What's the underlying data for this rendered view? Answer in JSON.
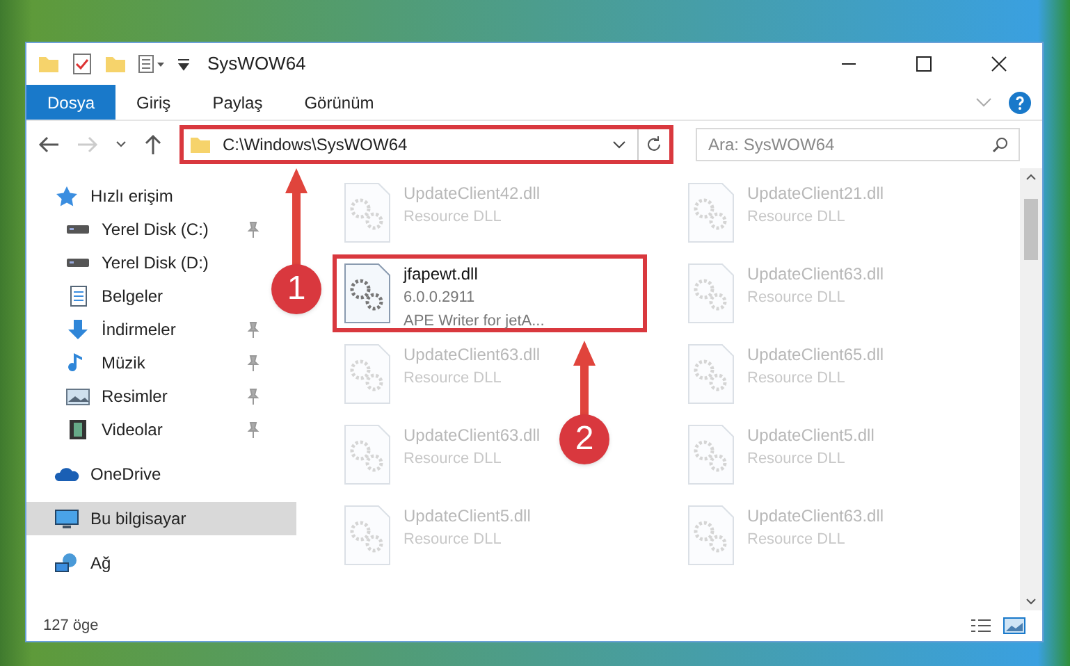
{
  "window": {
    "title": "SysWOW64"
  },
  "ribbon_tabs": [
    {
      "label": "Dosya",
      "selected": true
    },
    {
      "label": "Giriş",
      "selected": false
    },
    {
      "label": "Paylaş",
      "selected": false
    },
    {
      "label": "Görünüm",
      "selected": false
    }
  ],
  "address": {
    "path": "C:\\Windows\\SysWOW64",
    "highlighted": true
  },
  "search": {
    "placeholder": "Ara: SysWOW64"
  },
  "sidebar": {
    "items": [
      {
        "label": "Hızlı erişim",
        "kind": "star",
        "pinned": false,
        "selected": false,
        "children": [
          {
            "label": "Yerel Disk (C:)",
            "kind": "disk",
            "pinned": true,
            "selected": false
          },
          {
            "label": "Yerel Disk (D:)",
            "kind": "disk",
            "pinned": false,
            "selected": false
          },
          {
            "label": "Belgeler",
            "kind": "doc",
            "pinned": false,
            "selected": false
          },
          {
            "label": "İndirmeler",
            "kind": "download",
            "pinned": true,
            "selected": false
          },
          {
            "label": "Müzik",
            "kind": "music",
            "pinned": true,
            "selected": false
          },
          {
            "label": "Resimler",
            "kind": "picture",
            "pinned": true,
            "selected": false
          },
          {
            "label": "Videolar",
            "kind": "video",
            "pinned": true,
            "selected": false
          }
        ]
      },
      {
        "label": "OneDrive",
        "kind": "cloud",
        "pinned": false,
        "selected": false
      },
      {
        "label": "Bu bilgisayar",
        "kind": "computer",
        "pinned": false,
        "selected": true
      },
      {
        "label": "Ağ",
        "kind": "network",
        "pinned": false,
        "selected": false
      }
    ]
  },
  "files": [
    {
      "name": "UpdateClient42.dll",
      "lines": [
        "Resource DLL"
      ],
      "dimmed": true,
      "highlighted": false
    },
    {
      "name": "UpdateClient21.dll",
      "lines": [
        "Resource DLL"
      ],
      "dimmed": true,
      "highlighted": false
    },
    {
      "name": "jfapewt.dll",
      "lines": [
        "6.0.0.2911",
        "APE Writer for jetA..."
      ],
      "dimmed": false,
      "highlighted": true
    },
    {
      "name": "UpdateClient63.dll",
      "lines": [
        "Resource DLL"
      ],
      "dimmed": true,
      "highlighted": false
    },
    {
      "name": "UpdateClient63.dll",
      "lines": [
        "Resource DLL"
      ],
      "dimmed": true,
      "highlighted": false
    },
    {
      "name": "UpdateClient65.dll",
      "lines": [
        "Resource DLL"
      ],
      "dimmed": true,
      "highlighted": false
    },
    {
      "name": "UpdateClient63.dll",
      "lines": [
        "Resource DLL"
      ],
      "dimmed": true,
      "highlighted": false
    },
    {
      "name": "UpdateClient5.dll",
      "lines": [
        "Resource DLL"
      ],
      "dimmed": true,
      "highlighted": false
    },
    {
      "name": "UpdateClient5.dll",
      "lines": [
        "Resource DLL"
      ],
      "dimmed": true,
      "highlighted": false
    },
    {
      "name": "UpdateClient63.dll",
      "lines": [
        "Resource DLL"
      ],
      "dimmed": true,
      "highlighted": false
    }
  ],
  "status_bar": {
    "count": "127 öge"
  },
  "annotations": [
    {
      "label": "1"
    },
    {
      "label": "2"
    }
  ]
}
